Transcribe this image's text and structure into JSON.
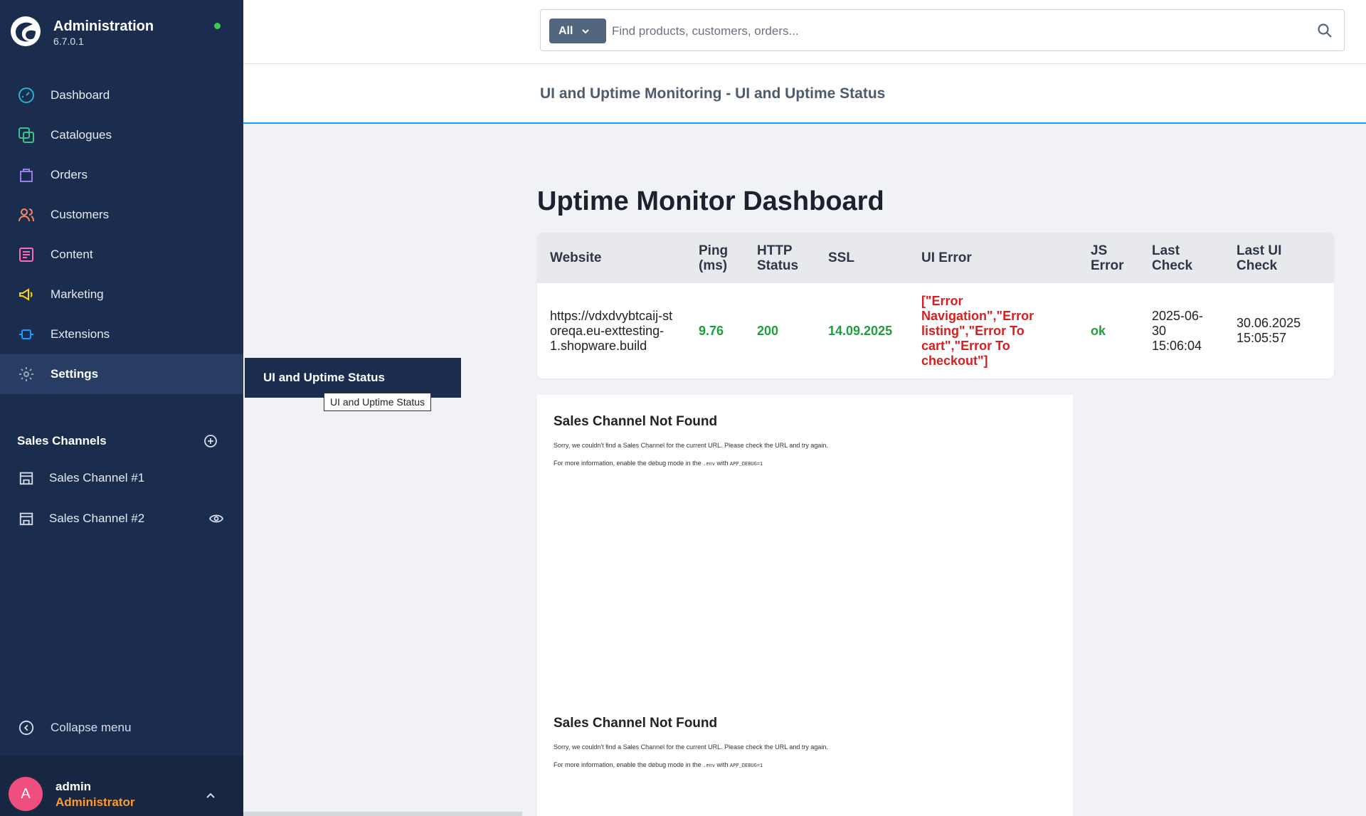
{
  "brand": {
    "title": "Administration",
    "version": "6.7.0.1"
  },
  "nav": [
    {
      "label": "Dashboard",
      "icon": "dashboard-icon",
      "color": "#26b0d4"
    },
    {
      "label": "Catalogues",
      "icon": "catalogue-icon",
      "color": "#3cc38c"
    },
    {
      "label": "Orders",
      "icon": "orders-icon",
      "color": "#9d7cf0"
    },
    {
      "label": "Customers",
      "icon": "customers-icon",
      "color": "#f88962"
    },
    {
      "label": "Content",
      "icon": "content-icon",
      "color": "#ff68b4"
    },
    {
      "label": "Marketing",
      "icon": "marketing-icon",
      "color": "#ffd700"
    },
    {
      "label": "Extensions",
      "icon": "extensions-icon",
      "color": "#189eff"
    },
    {
      "label": "Settings",
      "icon": "settings-icon",
      "color": "#9aa8b5"
    }
  ],
  "sales_channels": {
    "title": "Sales Channels",
    "items": [
      {
        "label": "Sales Channel #1"
      },
      {
        "label": "Sales Channel #2"
      }
    ]
  },
  "collapse_label": "Collapse menu",
  "user": {
    "initial": "A",
    "name": "admin",
    "role": "Administrator"
  },
  "flyout": {
    "label": "UI and Uptime Status",
    "tooltip": "UI and Uptime Status"
  },
  "search": {
    "type_label": "All",
    "placeholder": "Find products, customers, orders..."
  },
  "page_title": "UI and Uptime Monitoring - UI and Uptime Status",
  "dashboard": {
    "title": "Uptime Monitor Dashboard",
    "headers": [
      "Website",
      "Ping (ms)",
      "HTTP Status",
      "SSL",
      "UI Error",
      "JS Error",
      "Last Check",
      "Last UI Check"
    ],
    "row": {
      "website": "https://vdxdvybtcaij-storeqa.eu-exttesting-1.shopware.build",
      "ping": "9.76",
      "http": "200",
      "ssl": "14.09.2025",
      "ui_error": "[\"Error Navigation\",\"Error listing\",\"Error To cart\",\"Error To checkout\"]",
      "js_error": "ok",
      "last_check": "2025-06-30 15:06:04",
      "last_ui_check": "30.06.2025 15:05:57"
    }
  },
  "not_found": {
    "title": "Sales Channel Not Found",
    "line1": "Sorry, we couldn't find a Sales Channel for the current URL. Please check the URL and try again.",
    "line2_prefix": "For more information, enable the debug mode in the",
    "line2_env": ".env",
    "line2_mid": "with",
    "line2_flag": "APP_DEBUG=1"
  }
}
